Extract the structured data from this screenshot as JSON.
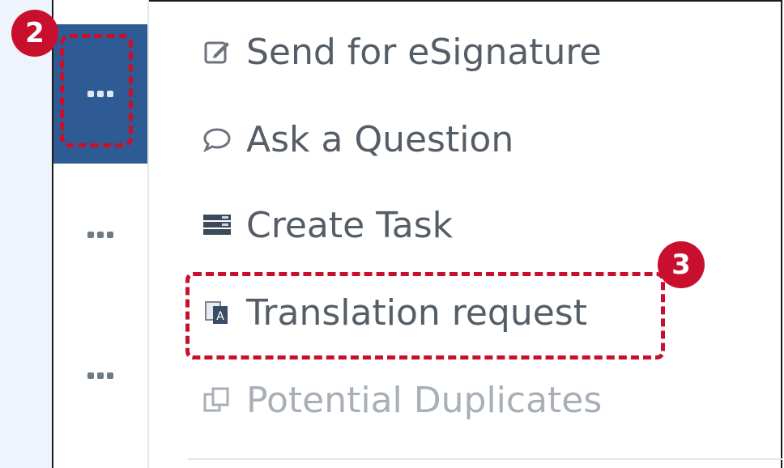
{
  "annotations": {
    "step2": "2",
    "step3": "3"
  },
  "menu": {
    "items": [
      {
        "label": "Send for eSignature",
        "icon": "edit-icon"
      },
      {
        "label": "Ask a Question",
        "icon": "speech-bubble-icon"
      },
      {
        "label": "Create Task",
        "icon": "task-list-icon"
      },
      {
        "label": "Translation request",
        "icon": "translate-icon"
      },
      {
        "label": "Potential Duplicates",
        "icon": "duplicate-icon",
        "state": "disabled"
      }
    ]
  },
  "colors": {
    "accent_red": "#c8102e",
    "active_blue": "#2e5b93",
    "text": "#555d66"
  }
}
